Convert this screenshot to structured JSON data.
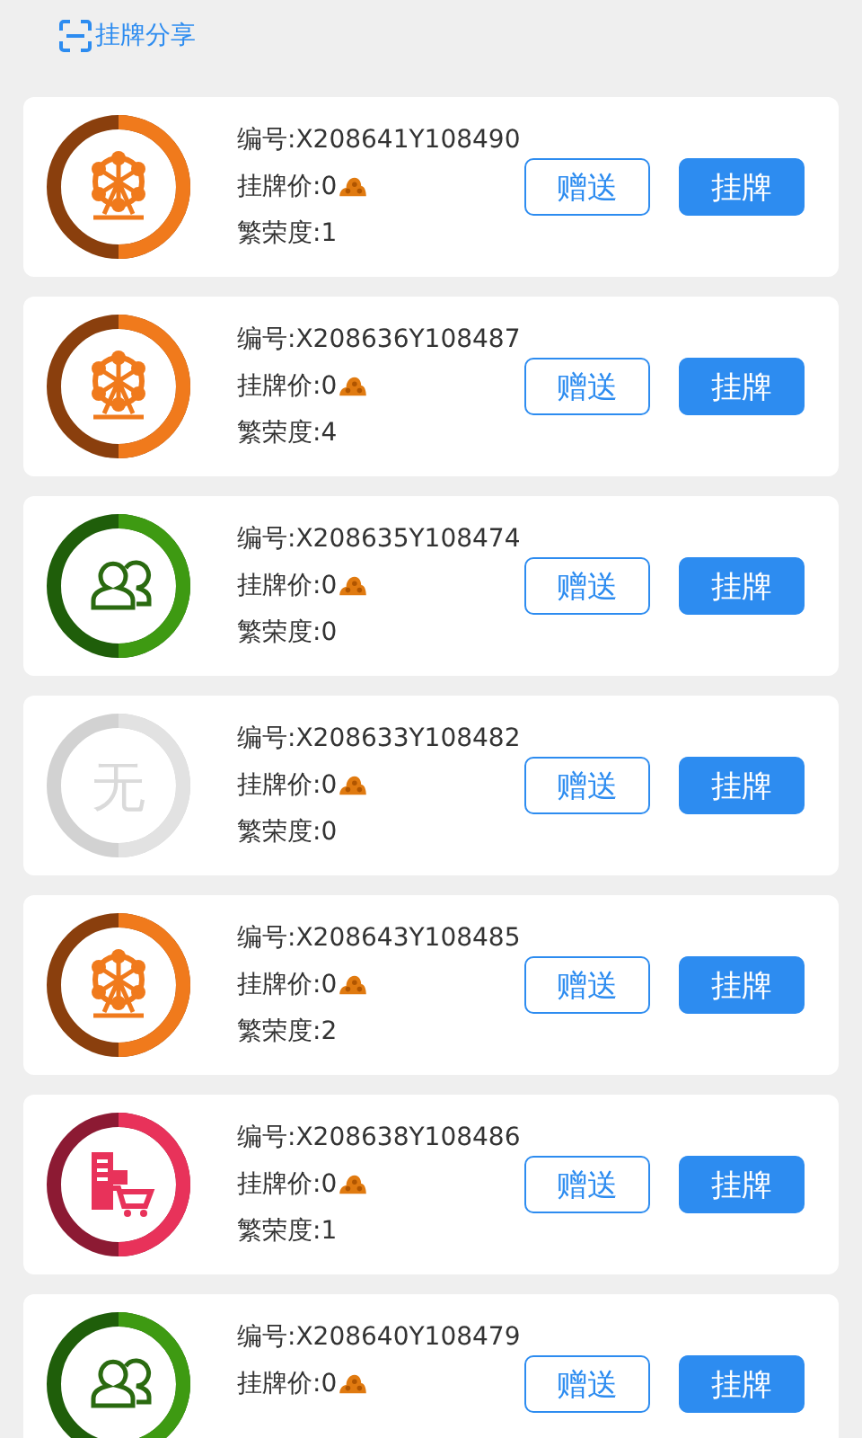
{
  "header": {
    "title": "挂牌分享"
  },
  "items": [
    {
      "kind": "wheel",
      "code": "编号:X208641Y108490",
      "price": "挂牌价:0",
      "prosperity": "繁荣度:1",
      "gift": "赠送",
      "list": "挂牌"
    },
    {
      "kind": "wheel",
      "code": "编号:X208636Y108487",
      "price": "挂牌价:0",
      "prosperity": "繁荣度:4",
      "gift": "赠送",
      "list": "挂牌"
    },
    {
      "kind": "people",
      "code": "编号:X208635Y108474",
      "price": "挂牌价:0",
      "prosperity": "繁荣度:0",
      "gift": "赠送",
      "list": "挂牌"
    },
    {
      "kind": "none",
      "badge": "无",
      "code": "编号:X208633Y108482",
      "price": "挂牌价:0",
      "prosperity": "繁荣度:0",
      "gift": "赠送",
      "list": "挂牌"
    },
    {
      "kind": "wheel",
      "code": "编号:X208643Y108485",
      "price": "挂牌价:0",
      "prosperity": "繁荣度:2",
      "gift": "赠送",
      "list": "挂牌"
    },
    {
      "kind": "shop",
      "code": "编号:X208638Y108486",
      "price": "挂牌价:0",
      "prosperity": "繁荣度:1",
      "gift": "赠送",
      "list": "挂牌"
    },
    {
      "kind": "people",
      "code": "编号:X208640Y108479",
      "price": "挂牌价:0",
      "gift": "赠送",
      "list": "挂牌"
    }
  ]
}
